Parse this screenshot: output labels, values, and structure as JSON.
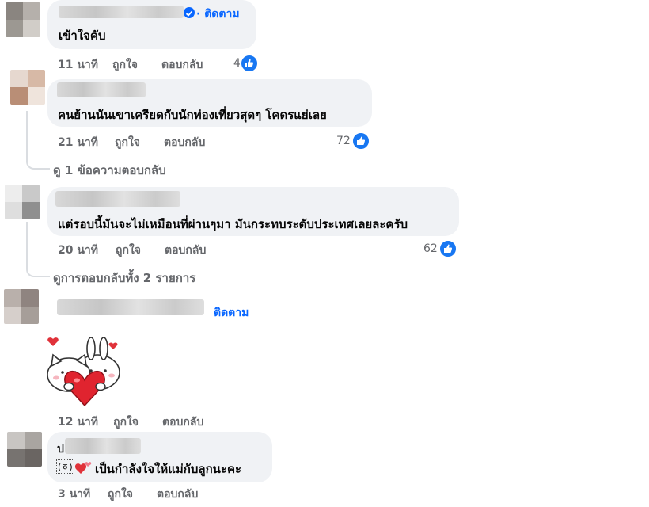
{
  "colors": {
    "link": "#0866ff",
    "meta": "#65676b",
    "bubble": "#f0f2f5",
    "like": "#1877f2"
  },
  "comments": [
    {
      "follow_label": "· ติดตาม",
      "text": "เข้าใจคับ",
      "time": "11 นาที",
      "like": "ถูกใจ",
      "reply": "ตอบกลับ",
      "reactions": "4",
      "reaction_icon": "thumbs-up-icon"
    },
    {
      "text": "คนย้านนันเขาเครียดกับนักท่องเที่ยวสุดๆ โคดรแย่เลย",
      "time": "21 นาที",
      "like": "ถูกใจ",
      "reply": "ตอบกลับ",
      "reactions": "72",
      "reaction_icon": "thumbs-up-icon",
      "view_replies": "ดู 1 ข้อความตอบกลับ"
    },
    {
      "text": "แต่รอบนี้มันจะไม่เหมือนที่ผ่านๆมา มันกระทบระดับประเทศเลยละครับ",
      "time": "20 นาที",
      "like": "ถูกใจ",
      "reply": "ตอบกลับ",
      "reactions": "62",
      "reaction_icon": "thumbs-up-icon",
      "view_replies": "ดูการตอบกลับทั้ง 2 รายการ"
    },
    {
      "follow_label": "ติดตาม",
      "sticker": "cat-bunny-heart-sticker",
      "time": "12 นาที",
      "like": "ถูกใจ",
      "reply": "ตอบกลับ"
    },
    {
      "name_initial": "ป",
      "text_prefix": "(ㆆ)",
      "text": "เป็นกำลังใจให้แม่กับลูกนะคะ",
      "time": "3 นาที",
      "like": "ถูกใจ",
      "reply": "ตอบกลับ"
    }
  ]
}
